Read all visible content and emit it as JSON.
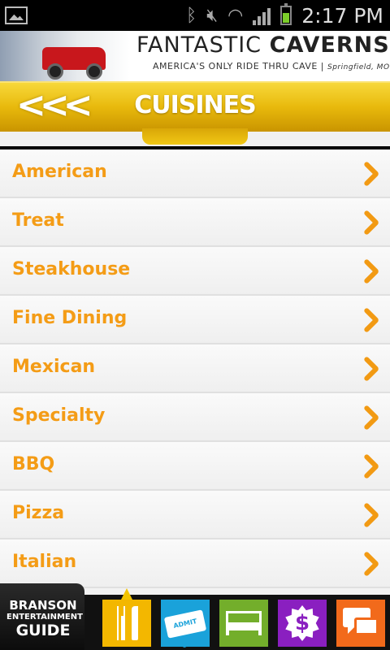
{
  "status_bar": {
    "time": "2:17 PM",
    "icons": [
      "image-icon",
      "bluetooth-icon",
      "mute-icon",
      "wifi-icon",
      "signal-icon",
      "battery-icon"
    ]
  },
  "ad_banner": {
    "title_light": "FANTASTIC ",
    "title_bold": "CAVERNS",
    "tagline": "AMERICA'S ONLY RIDE THRU CAVE | ",
    "location": "Springfield, MO"
  },
  "header": {
    "back_label": "<<<",
    "title": "CUISINES",
    "accent_color": "#f2c20f"
  },
  "cuisines": {
    "items": [
      {
        "label": "American"
      },
      {
        "label": "Treat"
      },
      {
        "label": "Steakhouse"
      },
      {
        "label": "Fine Dining"
      },
      {
        "label": "Mexican"
      },
      {
        "label": "Specialty"
      },
      {
        "label": "BBQ"
      },
      {
        "label": "Pizza"
      },
      {
        "label": "Italian"
      }
    ],
    "label_color": "#f49c16"
  },
  "bottom_nav": {
    "brand_line1": "BRANSON",
    "brand_line2": "ENTERTAINMENT",
    "brand_line3": "GUIDE",
    "ticket_label": "ADMIT ONE",
    "deals_symbol": "$",
    "buttons": [
      {
        "icon": "fork-knife-icon",
        "color": "#f3b700",
        "active": true
      },
      {
        "icon": "ticket-icon",
        "color": "#1aa2da"
      },
      {
        "icon": "bed-icon",
        "color": "#73ae2b"
      },
      {
        "icon": "dollar-badge-icon",
        "color": "#8a1fc0"
      },
      {
        "icon": "chat-icon",
        "color": "#f26a1b"
      }
    ]
  }
}
